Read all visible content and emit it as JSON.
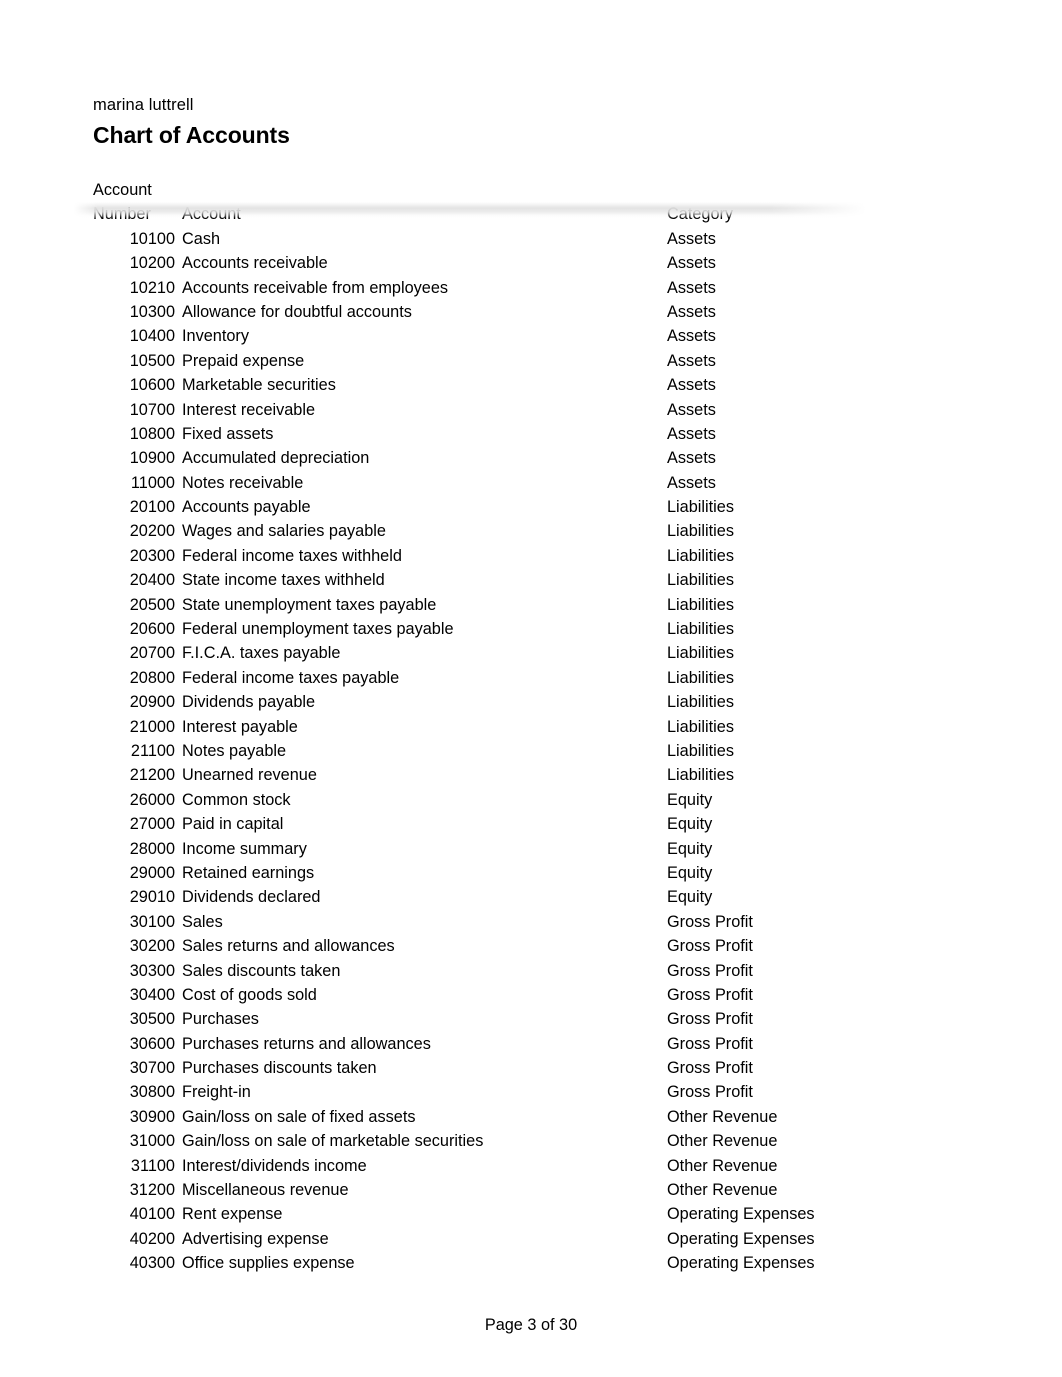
{
  "document": {
    "author": "marina luttrell",
    "title": "Chart of Accounts"
  },
  "table": {
    "headers": {
      "number_line1": "Account",
      "number_line2": "Number",
      "account": "Account",
      "category": "Category"
    },
    "rows": [
      {
        "number": "10100",
        "account": "Cash",
        "category": "Assets"
      },
      {
        "number": "10200",
        "account": "Accounts receivable",
        "category": "Assets"
      },
      {
        "number": "10210",
        "account": "Accounts receivable from employees",
        "category": "Assets"
      },
      {
        "number": "10300",
        "account": "Allowance for doubtful accounts",
        "category": "Assets"
      },
      {
        "number": "10400",
        "account": "Inventory",
        "category": "Assets"
      },
      {
        "number": "10500",
        "account": "Prepaid expense",
        "category": "Assets"
      },
      {
        "number": "10600",
        "account": "Marketable securities",
        "category": "Assets"
      },
      {
        "number": "10700",
        "account": "Interest receivable",
        "category": "Assets"
      },
      {
        "number": "10800",
        "account": "Fixed assets",
        "category": "Assets"
      },
      {
        "number": "10900",
        "account": "Accumulated depreciation",
        "category": "Assets"
      },
      {
        "number": "11000",
        "account": "Notes receivable",
        "category": "Assets"
      },
      {
        "number": "20100",
        "account": "Accounts payable",
        "category": "Liabilities"
      },
      {
        "number": "20200",
        "account": "Wages and salaries payable",
        "category": "Liabilities"
      },
      {
        "number": "20300",
        "account": "Federal income taxes withheld",
        "category": "Liabilities"
      },
      {
        "number": "20400",
        "account": "State income taxes withheld",
        "category": "Liabilities"
      },
      {
        "number": "20500",
        "account": "State unemployment taxes payable",
        "category": "Liabilities"
      },
      {
        "number": "20600",
        "account": "Federal unemployment taxes payable",
        "category": "Liabilities"
      },
      {
        "number": "20700",
        "account": "F.I.C.A. taxes payable",
        "category": "Liabilities"
      },
      {
        "number": "20800",
        "account": "Federal income taxes payable",
        "category": "Liabilities"
      },
      {
        "number": "20900",
        "account": "Dividends payable",
        "category": "Liabilities"
      },
      {
        "number": "21000",
        "account": "Interest payable",
        "category": "Liabilities"
      },
      {
        "number": "21100",
        "account": "Notes payable",
        "category": "Liabilities"
      },
      {
        "number": "21200",
        "account": "Unearned revenue",
        "category": "Liabilities"
      },
      {
        "number": "26000",
        "account": "Common stock",
        "category": "Equity"
      },
      {
        "number": "27000",
        "account": "Paid in capital",
        "category": "Equity"
      },
      {
        "number": "28000",
        "account": "Income summary",
        "category": "Equity"
      },
      {
        "number": "29000",
        "account": "Retained earnings",
        "category": "Equity"
      },
      {
        "number": "29010",
        "account": "Dividends declared",
        "category": "Equity"
      },
      {
        "number": "30100",
        "account": "Sales",
        "category": "Gross Profit"
      },
      {
        "number": "30200",
        "account": "Sales returns and allowances",
        "category": "Gross Profit"
      },
      {
        "number": "30300",
        "account": "Sales discounts taken",
        "category": "Gross Profit"
      },
      {
        "number": "30400",
        "account": "Cost of goods sold",
        "category": "Gross Profit"
      },
      {
        "number": "30500",
        "account": "Purchases",
        "category": "Gross Profit"
      },
      {
        "number": "30600",
        "account": "Purchases returns and allowances",
        "category": "Gross Profit"
      },
      {
        "number": "30700",
        "account": "Purchases discounts taken",
        "category": "Gross Profit"
      },
      {
        "number": "30800",
        "account": "Freight-in",
        "category": "Gross Profit"
      },
      {
        "number": "30900",
        "account": "Gain/loss on sale of fixed assets",
        "category": "Other Revenue"
      },
      {
        "number": "31000",
        "account": "Gain/loss on sale of marketable securities",
        "category": "Other Revenue"
      },
      {
        "number": "31100",
        "account": "Interest/dividends income",
        "category": "Other Revenue"
      },
      {
        "number": "31200",
        "account": "Miscellaneous revenue",
        "category": "Other Revenue"
      },
      {
        "number": "40100",
        "account": "Rent expense",
        "category": "Operating Expenses"
      },
      {
        "number": "40200",
        "account": "Advertising expense",
        "category": "Operating Expenses"
      },
      {
        "number": "40300",
        "account": "Office supplies expense",
        "category": "Operating Expenses"
      }
    ]
  },
  "footer": {
    "page_label": "Page 3 of 30"
  }
}
